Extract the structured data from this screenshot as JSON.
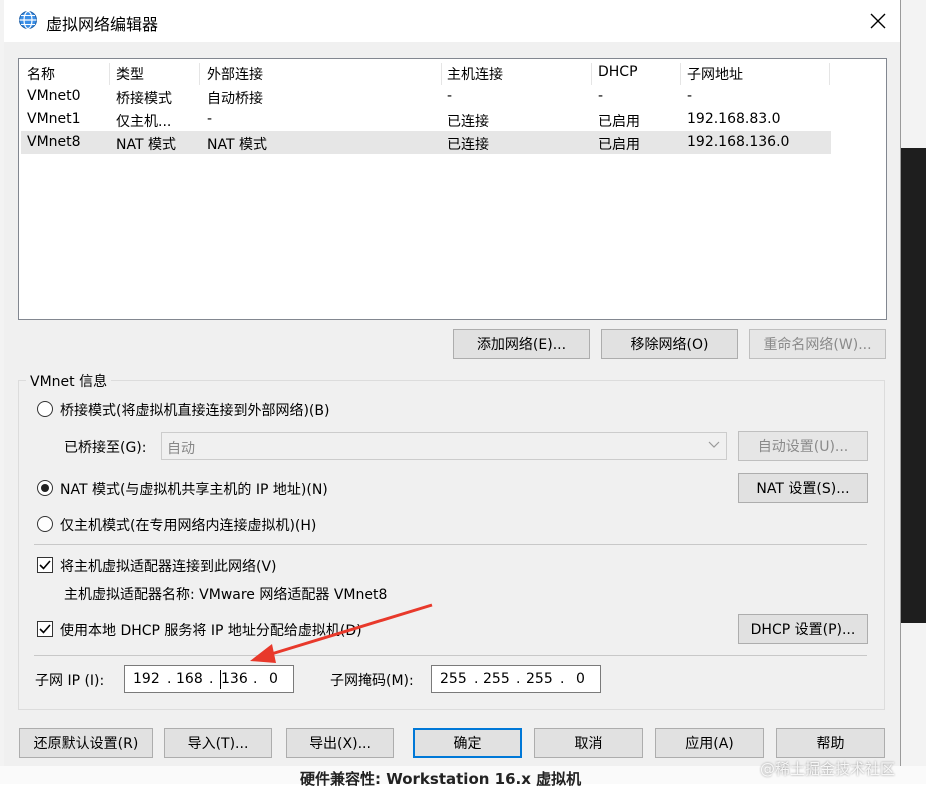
{
  "window": {
    "title": "虚拟网络编辑器",
    "icon": "globe-network-icon"
  },
  "table": {
    "columns": [
      "名称",
      "类型",
      "外部连接",
      "主机连接",
      "DHCP",
      "子网地址"
    ],
    "rows": [
      {
        "name": "VMnet0",
        "type": "桥接模式",
        "external": "自动桥接",
        "host": "-",
        "dhcp": "-",
        "subnet": "-"
      },
      {
        "name": "VMnet1",
        "type": "仅主机...",
        "external": "-",
        "host": "已连接",
        "dhcp": "已启用",
        "subnet": "192.168.83.0"
      },
      {
        "name": "VMnet8",
        "type": "NAT 模式",
        "external": "NAT 模式",
        "host": "已连接",
        "dhcp": "已启用",
        "subnet": "192.168.136.0"
      }
    ],
    "selected_row": "VMnet8"
  },
  "network_buttons": {
    "add": "添加网络(E)...",
    "remove": "移除网络(O)",
    "rename": "重命名网络(W)..."
  },
  "vmnet_info": {
    "group_title": "VMnet 信息",
    "bridged_label": "桥接模式(将虚拟机直接连接到外部网络)(B)",
    "bridged_to_label": "已桥接至(G):",
    "bridged_to_value": "自动",
    "auto_settings": "自动设置(U)...",
    "nat_label": "NAT 模式(与虚拟机共享主机的 IP 地址)(N)",
    "nat_settings": "NAT 设置(S)...",
    "host_only_label": "仅主机模式(在专用网络内连接虚拟机)(H)",
    "connect_adapter_label": "将主机虚拟适配器连接到此网络(V)",
    "adapter_name_label": "主机虚拟适配器名称: VMware 网络适配器 VMnet8",
    "use_dhcp_label": "使用本地 DHCP 服务将 IP 地址分配给虚拟机(D)",
    "dhcp_settings": "DHCP 设置(P)...",
    "subnet_ip_label": "子网 IP (I):",
    "subnet_ip": [
      "192",
      "168",
      "136",
      "0"
    ],
    "subnet_mask_label": "子网掩码(M):",
    "subnet_mask": [
      "255",
      "255",
      "255",
      "0"
    ],
    "mode_selected": "nat",
    "connect_adapter_checked": true,
    "use_dhcp_checked": true
  },
  "footer_buttons": {
    "restore": "还原默认设置(R)",
    "import": "导入(T)...",
    "export": "导出(X)...",
    "ok": "确定",
    "cancel": "取消",
    "apply": "应用(A)",
    "help": "帮助"
  },
  "background": {
    "bottom_text": "硬件兼容性: Workstation 16.x 虚拟机",
    "watermark": "@稀土掘金技术社区"
  },
  "annotation": {
    "arrow_color": "#e8392b"
  }
}
